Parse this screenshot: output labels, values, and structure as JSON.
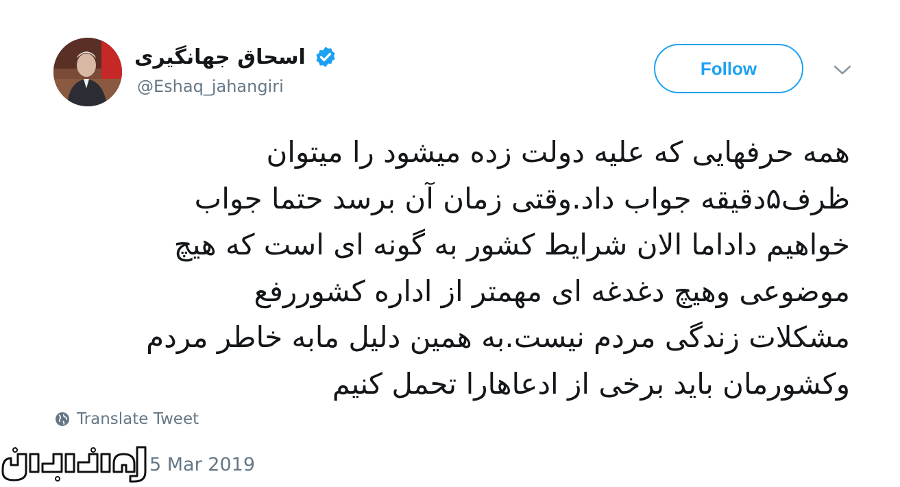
{
  "user": {
    "display_name": "اسحاق جهانگیری",
    "handle": "@Eshaq_jahangiri",
    "verified": true
  },
  "actions": {
    "follow_label": "Follow",
    "menu_icon": "chevron-down-icon"
  },
  "tweet": {
    "lines": [
      "همه حرفهایی که علیه دولت زده میشود را میتوان",
      "ظرف۵دقیقه جواب داد.وقتی زمان آن برسد حتما جواب",
      "خواهیم داداما الان شرایط کشور به گونه ای است که هیچ",
      "موضوعی وهیچ دغدغه ای مهمتر از اداره کشوررفع",
      "مشکلات زندگی مردم نیست.به همین دلیل مابه خاطر مردم",
      "وکشورمان باید برخی از ادعاهارا تحمل کنیم"
    ],
    "translate_label": "Translate Tweet",
    "timestamp": "5 Mar 2019"
  },
  "watermark": {
    "text": "جوان آنلاین"
  },
  "colors": {
    "accent": "#1da1f2",
    "text": "#14171a",
    "secondary": "#657786"
  }
}
